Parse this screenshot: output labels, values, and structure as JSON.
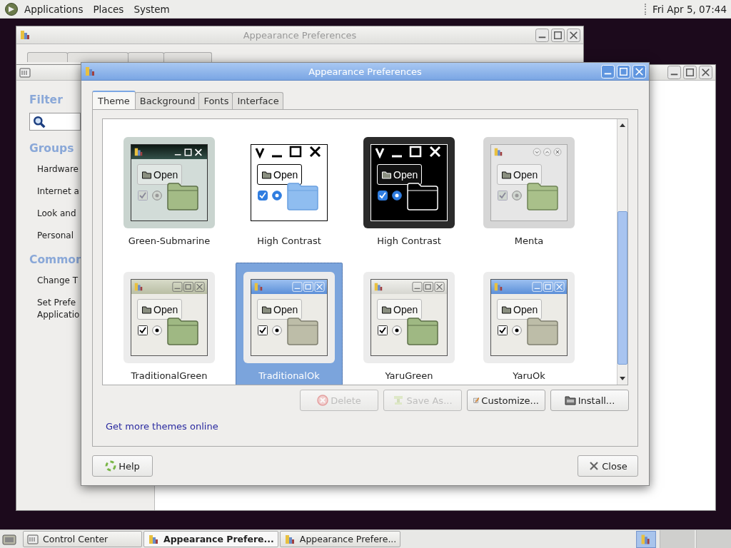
{
  "top_panel": {
    "menus": [
      "Applications",
      "Places",
      "System"
    ],
    "clock": "Fri Apr 5, 07:44"
  },
  "back_window": {
    "title": "Appearance Preferences"
  },
  "control_center": {
    "filter_heading": "Filter",
    "groups_heading": "Groups",
    "groups": [
      "Hardware",
      "Internet a",
      "Look and",
      "Personal"
    ],
    "tasks_heading": "Common",
    "tasks": [
      "Change T",
      "Set Prefe\nApplicatio"
    ]
  },
  "window": {
    "title": "Appearance Preferences",
    "tabs": [
      {
        "label": "Theme",
        "selected": true
      },
      {
        "label": "Background",
        "selected": false
      },
      {
        "label": "Fonts",
        "selected": false
      },
      {
        "label": "Interface",
        "selected": false
      }
    ],
    "themes": [
      {
        "name": "Green-Submarine",
        "kind": "green-submarine",
        "preview_label": "Open",
        "selected": false
      },
      {
        "name": "High Contrast",
        "kind": "high-contrast",
        "preview_label": "Open",
        "selected": false
      },
      {
        "name": "High Contrast",
        "kind": "high-contrast-inverse",
        "preview_label": "Open",
        "selected": false
      },
      {
        "name": "Menta",
        "kind": "menta",
        "preview_label": "Open",
        "selected": false
      },
      {
        "name": "TraditionalGreen",
        "kind": "traditional-green",
        "preview_label": "Open",
        "selected": false
      },
      {
        "name": "TraditionalOk",
        "kind": "traditional-ok",
        "preview_label": "Open",
        "selected": true
      },
      {
        "name": "YaruGreen",
        "kind": "yaru-green",
        "preview_label": "Open",
        "selected": false
      },
      {
        "name": "YaruOk",
        "kind": "yaru-ok",
        "preview_label": "Open",
        "selected": false
      }
    ],
    "actions": [
      {
        "label": "Delete",
        "kind": "delete",
        "disabled": true
      },
      {
        "label": "Save As...",
        "kind": "save",
        "disabled": true
      },
      {
        "label": "Customize...",
        "kind": "customize",
        "disabled": false
      },
      {
        "label": "Install...",
        "kind": "install",
        "disabled": false
      }
    ],
    "link": "Get more themes online",
    "help": "Help",
    "close": "Close"
  },
  "taskbar": [
    {
      "label": "Control Center",
      "kind": "control",
      "selected": false
    },
    {
      "label": "Appearance Prefere...",
      "kind": "appearance",
      "selected": true
    },
    {
      "label": "Appearance Prefere...",
      "kind": "appearance",
      "selected": false
    }
  ]
}
